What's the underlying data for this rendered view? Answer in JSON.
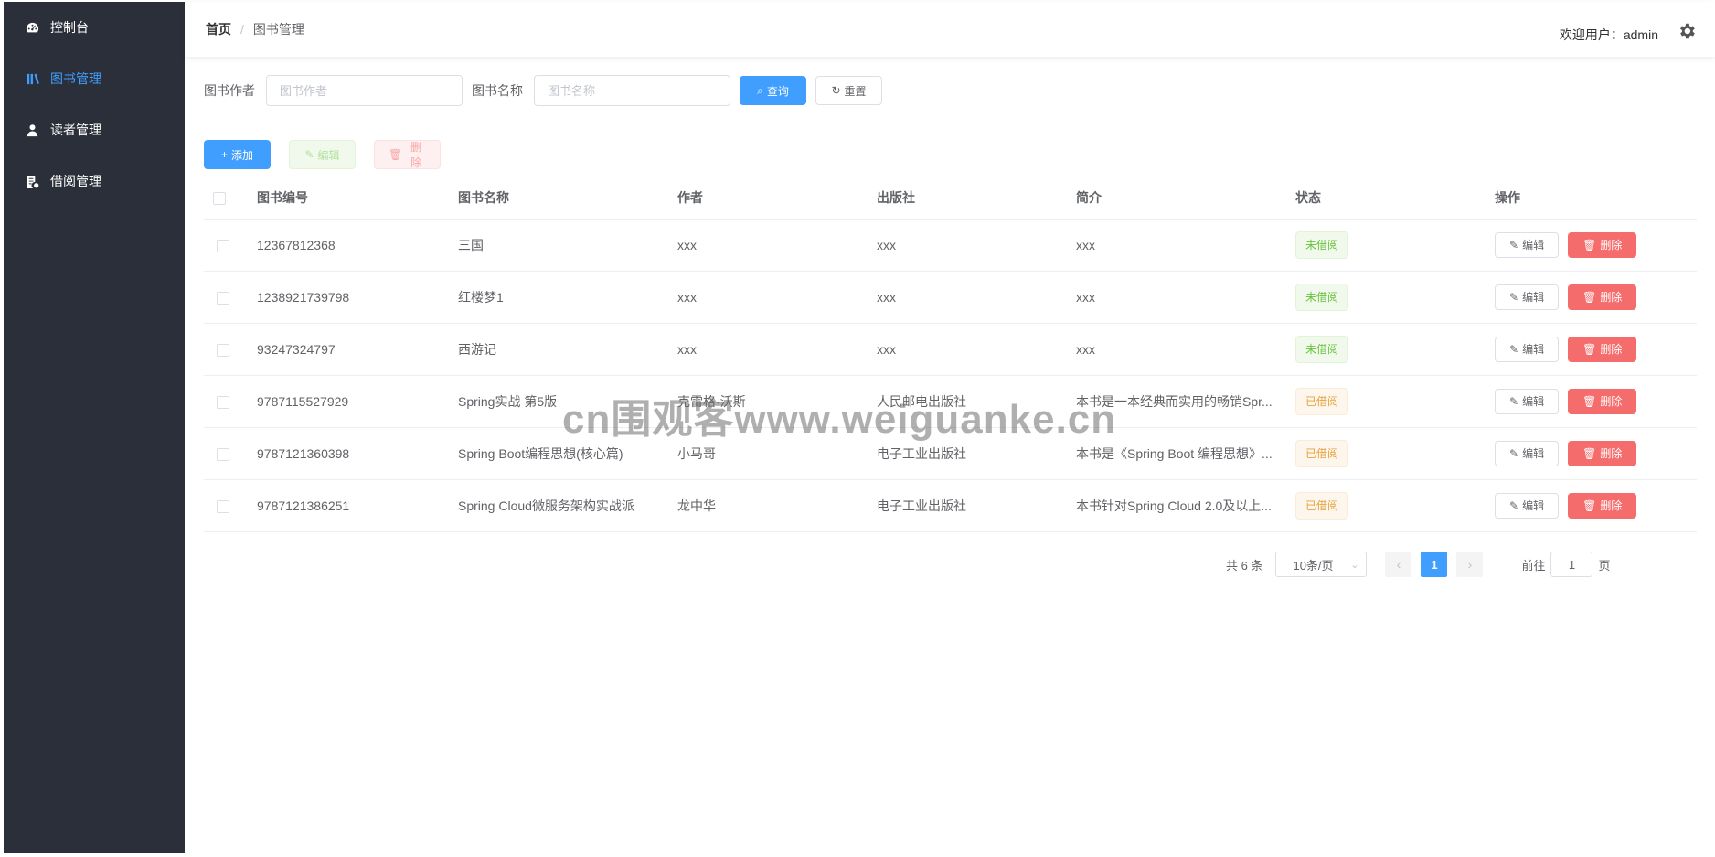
{
  "sidebar": {
    "items": [
      {
        "label": "控制台",
        "icon": "dashboard-icon"
      },
      {
        "label": "图书管理",
        "icon": "book-icon",
        "active": true
      },
      {
        "label": "读者管理",
        "icon": "user-icon"
      },
      {
        "label": "借阅管理",
        "icon": "document-icon"
      }
    ]
  },
  "header": {
    "breadcrumb": {
      "home": "首页",
      "separator": "/",
      "current": "图书管理"
    },
    "welcome": "欢迎用户：admin",
    "settings_icon": "gear-icon"
  },
  "search": {
    "author_label": "图书作者",
    "author_placeholder": "图书作者",
    "author_value": "",
    "name_label": "图书名称",
    "name_placeholder": "图书名称",
    "name_value": "",
    "query_label": "查询",
    "reset_label": "重置"
  },
  "toolbar": {
    "add_label": "添加",
    "edit_label": "编辑",
    "delete_label": "删除"
  },
  "table": {
    "columns": [
      "图书编号",
      "图书名称",
      "作者",
      "出版社",
      "简介",
      "状态",
      "操作"
    ],
    "rows": [
      {
        "id": "12367812368",
        "name": "三国",
        "author": "xxx",
        "publisher": "xxx",
        "intro": "xxx",
        "status": "未借阅",
        "status_type": "green"
      },
      {
        "id": "1238921739798",
        "name": "红楼梦1",
        "author": "xxx",
        "publisher": "xxx",
        "intro": "xxx",
        "status": "未借阅",
        "status_type": "green"
      },
      {
        "id": "93247324797",
        "name": "西游记",
        "author": "xxx",
        "publisher": "xxx",
        "intro": "xxx",
        "status": "未借阅",
        "status_type": "green"
      },
      {
        "id": "9787115527929",
        "name": "Spring实战 第5版",
        "author": "克雷格·沃斯",
        "publisher": "人民邮电出版社",
        "intro": "本书是一本经典而实用的畅销Spr...",
        "status": "已借阅",
        "status_type": "orange"
      },
      {
        "id": "9787121360398",
        "name": "Spring Boot编程思想(核心篇)",
        "author": "小马哥",
        "publisher": "电子工业出版社",
        "intro": "本书是《Spring Boot 编程思想》...",
        "status": "已借阅",
        "status_type": "orange"
      },
      {
        "id": "9787121386251",
        "name": "Spring Cloud微服务架构实战派",
        "author": "龙中华",
        "publisher": "电子工业出版社",
        "intro": "本书针对Spring Cloud 2.0及以上...",
        "status": "已借阅",
        "status_type": "orange"
      }
    ],
    "row_edit_label": "编辑",
    "row_delete_label": "删除"
  },
  "pagination": {
    "total_text": "共 6 条",
    "page_size": "10条/页",
    "current_page": "1",
    "jump_prefix": "前往",
    "jump_value": "1",
    "jump_suffix": "页"
  },
  "watermark": "cn围观客www.weiguanke.cn",
  "colors": {
    "primary": "#409eff",
    "danger": "#f56c6c",
    "success": "#67c23a",
    "warning": "#e6a23c",
    "sidebar_bg": "#2b2f3a"
  }
}
